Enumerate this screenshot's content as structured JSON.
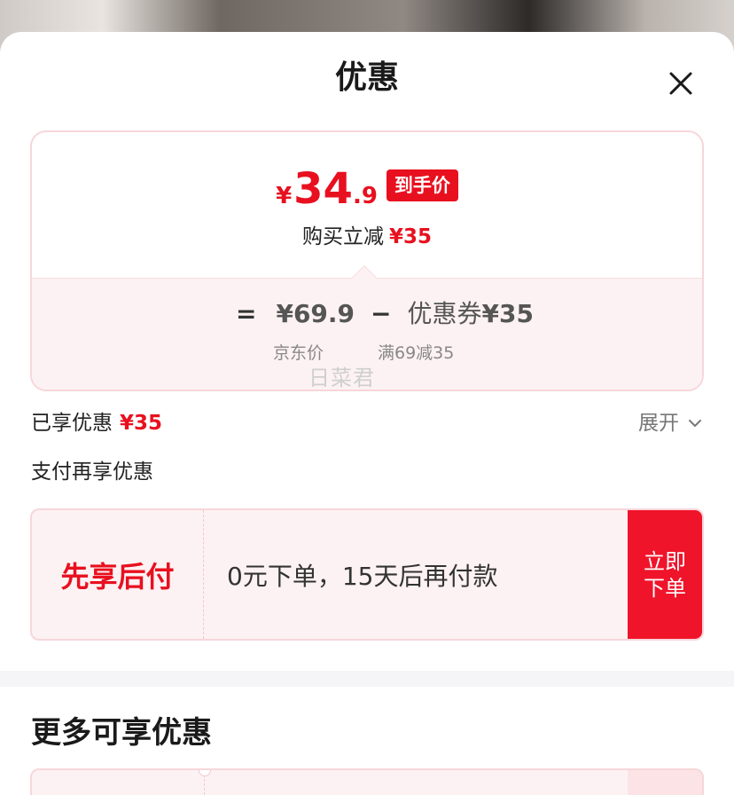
{
  "sheet": {
    "title": "优惠",
    "close_icon": "close-icon"
  },
  "price_card": {
    "currency": "¥",
    "final_int": "34",
    "final_dec": ".9",
    "badge": "到手价",
    "buy_label": "购买立减",
    "buy_amount": "¥35",
    "formula": {
      "equals": "=",
      "jd_price": "¥69.9",
      "minus": "−",
      "coupon_label": "优惠券",
      "coupon_amount": "¥35"
    },
    "jd_price_label": "京东价",
    "coupon_rule": "满69减35",
    "watermark": "日菜君"
  },
  "enjoyed": {
    "label": "已享优惠",
    "amount": "¥35",
    "expand_label": "展开"
  },
  "pay_more_label": "支付再享优惠",
  "bnpl": {
    "title": "先享后付",
    "description": "0元下单，15天后再付款",
    "button_line1": "立即",
    "button_line2": "下单"
  },
  "more_section_title": "更多可享优惠",
  "colors": {
    "accent_red": "#e8101f",
    "card_border": "#f7d6da",
    "card_tint": "#fdf2f3"
  }
}
